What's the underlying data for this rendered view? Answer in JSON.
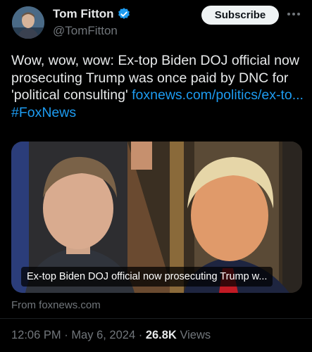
{
  "author": {
    "name": "Tom Fitton",
    "handle": "@TomFitton",
    "verified": true
  },
  "actions": {
    "subscribe_label": "Subscribe",
    "more_label": "···"
  },
  "tweet": {
    "text": "Wow, wow, wow: Ex-top Biden DOJ official now prosecuting Trump was once paid by DNC for 'political consulting'",
    "link_text": "foxnews.com/politics/ex-to...",
    "hashtag": "#FoxNews"
  },
  "card": {
    "caption": "Ex-top Biden DOJ official now prosecuting Trump w...",
    "source": "From foxnews.com"
  },
  "meta": {
    "time": "12:06 PM",
    "separator": "·",
    "date": "May 6, 2024",
    "views_count": "26.8K",
    "views_label": "Views"
  },
  "colors": {
    "background": "#000000",
    "accent": "#1d9bf0",
    "secondary_text": "#71767b"
  }
}
